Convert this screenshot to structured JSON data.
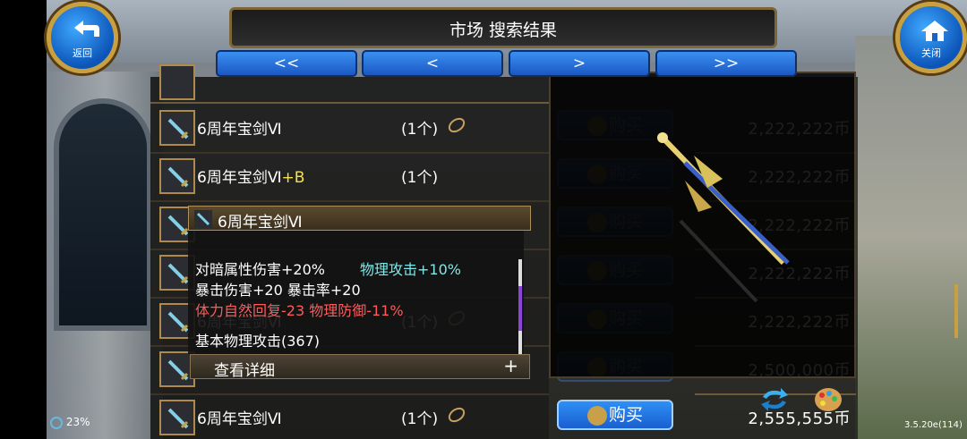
{
  "header": {
    "title": "市场 搜索结果",
    "back_label": "返回",
    "close_label": "关闭"
  },
  "pager": [
    "<<",
    "<",
    ">",
    ">>"
  ],
  "rows": [
    {
      "name": "6周年宝剑Ⅵ",
      "plus": "",
      "qty": "(1个)",
      "buy_label": "购买",
      "price": "2,222,222币"
    },
    {
      "name": "6周年宝剑Ⅵ",
      "plus": "+B",
      "qty": "(1个)",
      "buy_label": "购买",
      "price": "2,222,222币"
    },
    {
      "name": "",
      "plus": "",
      "qty": "",
      "buy_label": "购买",
      "price": "2,222,222币"
    },
    {
      "name": "",
      "plus": "",
      "qty": "",
      "buy_label": "购买",
      "price": "2,222,222币"
    },
    {
      "name": "6周年宝剑Ⅵ",
      "plus": "",
      "qty": "(1个)",
      "buy_label": "购买",
      "price": "2,222,222币"
    },
    {
      "name": "",
      "plus": "",
      "qty": "",
      "buy_label": "购买",
      "price": "2,500,000币"
    },
    {
      "name": "6周年宝剑Ⅵ",
      "plus": "",
      "qty": "(1个)",
      "buy_label": "购买",
      "price": "2,555,555币"
    }
  ],
  "tooltip": {
    "name": "6周年宝剑Ⅵ",
    "stats": [
      {
        "text": "对暗属性伤害+20%",
        "color": "white"
      },
      {
        "text": "物理攻击+10%",
        "color": "cyan"
      },
      {
        "text": "暴击伤害+20 暴击率+20",
        "color": "white"
      },
      {
        "text": "体力自然回复-23 物理防御-11%",
        "color": "red"
      },
      {
        "text": "基本物理攻击(367)",
        "color": "white"
      }
    ],
    "detail_label": "查看详细",
    "detail_plus": "+"
  },
  "status": {
    "battery": "23%",
    "version": "3.5.20e(114)"
  },
  "colors": {
    "buy_active": "#2f8ff5",
    "gold_border": "#c8a040",
    "red_stat": "#ff5a5a",
    "cyan_stat": "#7fe8e8"
  }
}
